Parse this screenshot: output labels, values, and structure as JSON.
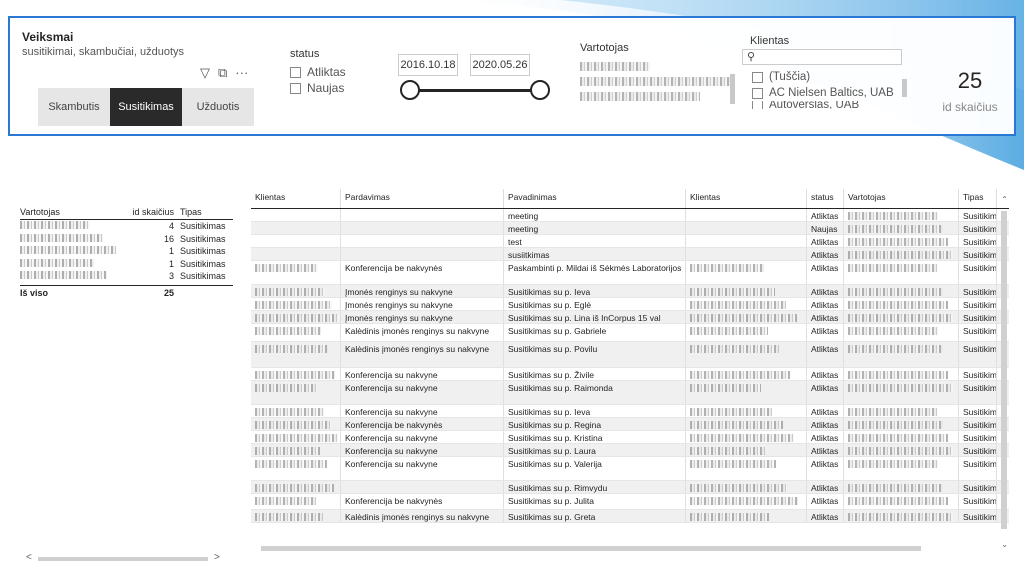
{
  "header": {
    "title": "Veiksmai",
    "subtitle": "susitikimai, skambučiai, užduotys"
  },
  "tabs": [
    {
      "label": "Skambutis",
      "active": false
    },
    {
      "label": "Susitikimas",
      "active": true
    },
    {
      "label": "Užduotis",
      "active": false
    }
  ],
  "status_filter": {
    "title": "status",
    "options": [
      "Atliktas",
      "Naujas"
    ]
  },
  "date_filter": {
    "start": "2016.10.18",
    "end": "2020.05.26"
  },
  "vartotojas_filter": {
    "title": "Vartotojas"
  },
  "klientas_filter": {
    "title": "Klientas",
    "options": [
      "(Tuščia)",
      "AC Nielsen Baltics, UAB",
      "Autoverslas, UAB"
    ]
  },
  "kpi": {
    "value": "25",
    "label": "id skaičius"
  },
  "summary_table": {
    "headers": [
      "Vartotojas",
      "id skaičius",
      "Tipas"
    ],
    "rows": [
      {
        "id": "4",
        "type": "Susitikimas"
      },
      {
        "id": "16",
        "type": "Susitikimas"
      },
      {
        "id": "1",
        "type": "Susitikimas"
      },
      {
        "id": "1",
        "type": "Susitikimas"
      },
      {
        "id": "3",
        "type": "Susitikimas"
      }
    ],
    "total_label": "Iš viso",
    "total_value": "25"
  },
  "main_table": {
    "headers": [
      "Klientas",
      "Pardavimas",
      "Pavadinimas",
      "Klientas",
      "status",
      "Vartotojas",
      "Tipas"
    ],
    "rows": [
      {
        "pard": "",
        "pav": "meeting",
        "status": "Atliktas",
        "tipas": "Susitikimas"
      },
      {
        "pard": "",
        "pav": "meeting",
        "status": "Naujas",
        "tipas": "Susitikimas"
      },
      {
        "pard": "",
        "pav": "test",
        "status": "Atliktas",
        "tipas": "Susitikimas"
      },
      {
        "pard": "",
        "pav": "susiitkimas",
        "status": "Atliktas",
        "tipas": "Susitikimas"
      },
      {
        "pard": "Konferencija be nakvynės",
        "pav": "Paskambinti p. Mildai iš Sėkmės Laboratorijos",
        "status": "Atliktas",
        "tipas": "Susitikimas"
      },
      {
        "pard": "Įmonės renginys su nakvyne",
        "pav": "Susitikimas su p. Ieva",
        "status": "Atliktas",
        "tipas": "Susitikimas"
      },
      {
        "pard": "Įmonės renginys su nakvyne",
        "pav": "Susitikimas su p. Eglė",
        "status": "Atliktas",
        "tipas": "Susitikimas"
      },
      {
        "pard": "Įmonės renginys su nakvyne",
        "pav": "Susitikimas su p. Lina iš InCorpus 15 val",
        "status": "Atliktas",
        "tipas": "Susitikimas"
      },
      {
        "pard": "Kalėdinis įmonės renginys su nakvyne",
        "pav": "Susitikimas su p. Gabriele",
        "status": "Atliktas",
        "tipas": "Susitikimas"
      },
      {
        "pard": "Kalėdinis įmonės renginys su nakvyne",
        "pav": "Susitikimas su p. Povilu",
        "status": "Atliktas",
        "tipas": "Susitikimas"
      },
      {
        "pard": "Konferencija su nakvyne",
        "pav": "Susitikimas su p. Živile",
        "status": "Atliktas",
        "tipas": "Susitikimas"
      },
      {
        "pard": "Konferencija su nakvyne",
        "pav": "Susitikimas su p. Raimonda",
        "status": "Atliktas",
        "tipas": "Susitikimas"
      },
      {
        "pard": "Konferencija su nakvyne",
        "pav": "Susitikimas su p. Ieva",
        "status": "Atliktas",
        "tipas": "Susitikimas"
      },
      {
        "pard": "Konferencija be nakvynės",
        "pav": "Susitikimas su p. Regina",
        "status": "Atliktas",
        "tipas": "Susitikimas"
      },
      {
        "pard": "Konferencija su nakvyne",
        "pav": "Susitikimas su p. Kristina",
        "status": "Atliktas",
        "tipas": "Susitikimas"
      },
      {
        "pard": "Konferencija su nakvyne",
        "pav": "Susitikimas su p. Laura",
        "status": "Atliktas",
        "tipas": "Susitikimas"
      },
      {
        "pard": "Konferencija su nakvyne",
        "pav": "Susitikimas su p. Valerija",
        "status": "Atliktas",
        "tipas": "Susitikimas"
      },
      {
        "pard": "",
        "pav": "Susitikimas su p. Rimvydu",
        "status": "Atliktas",
        "tipas": "Susitikimas"
      },
      {
        "pard": "Konferencija be nakvynės",
        "pav": "Susitikimas su p. Julita",
        "status": "Atliktas",
        "tipas": "Susitikimas"
      },
      {
        "pard": "Kalėdinis įmonės renginys su nakvyne",
        "pav": "Susitikimas su p. Greta",
        "status": "Atliktas",
        "tipas": "Susitikimas"
      }
    ]
  }
}
